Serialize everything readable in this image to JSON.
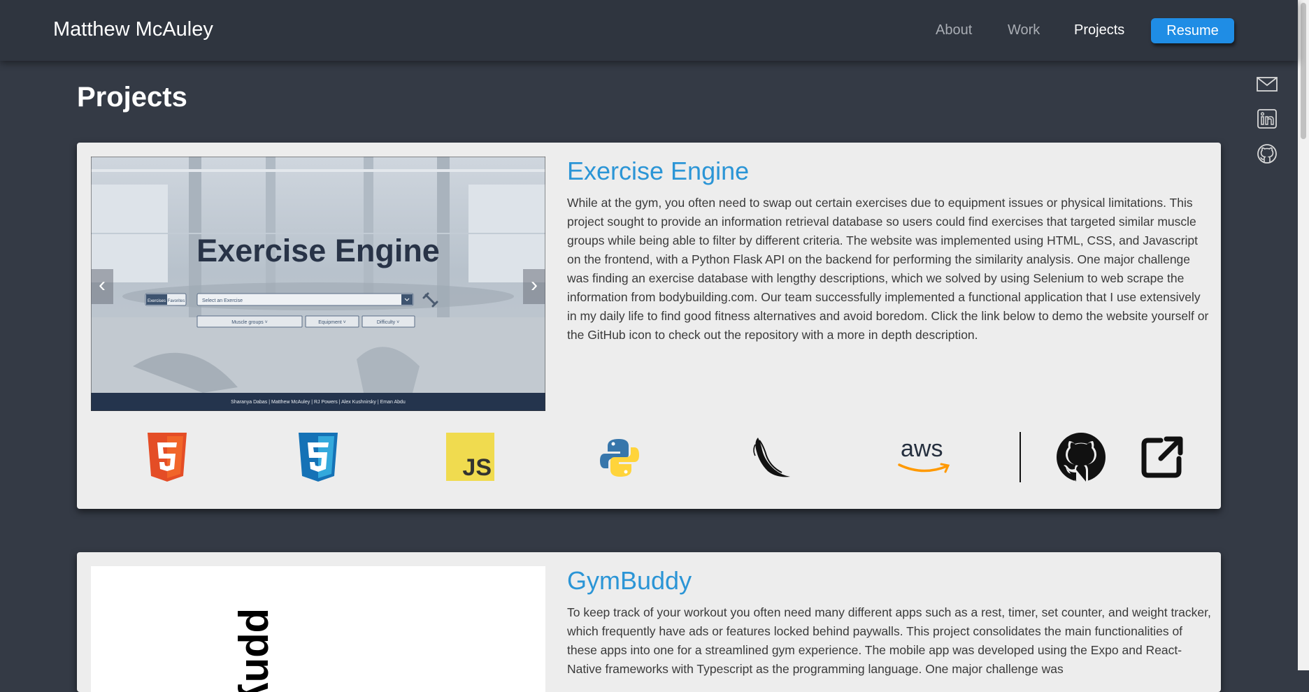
{
  "header": {
    "brand": "Matthew McAuley",
    "nav": {
      "about": "About",
      "work": "Work",
      "projects": "Projects",
      "resume": "Resume"
    }
  },
  "social": [
    "mail-icon",
    "linkedin-icon",
    "github-icon"
  ],
  "page_title": "Projects",
  "projects": [
    {
      "title": "Exercise Engine",
      "description": "While at the gym, you often need to swap out certain exercises due to equipment issues or physical limitations. This project sought to provide an information retrieval database so users could find exercises that targeted similar muscle groups while being able to filter by different criteria. The website was implemented using HTML, CSS, and Javascript on the frontend, with a Python Flask API on the backend for performing the similarity analysis. One major challenge was finding an exercise database with lengthy descriptions, which we solved by using Selenium to web scrape the information from bodybuilding.com. Our team successfully implemented a functional application that I use extensively in my daily life to find good fitness alternatives and avoid boredom. Click the link below to demo the website yourself or the GitHub icon to check out the repository with a more in depth description.",
      "screenshot": {
        "title": "Exercise Engine",
        "tab_exercises": "Exercises",
        "tab_favorites": "Favorites",
        "search_placeholder": "Select an Exercise",
        "filter_muscle": "Muscle groups ˅",
        "filter_equipment": "Equipment ˅",
        "filter_difficulty": "Difficulty ˅",
        "footer": "Sharanya Dabas | Matthew McAuley | RJ Powers | Alex Kushnirsky | Eman Abdu"
      },
      "tech": [
        "HTML5",
        "CSS3",
        "JavaScript",
        "Python",
        "Flask",
        "AWS"
      ],
      "js_label": "JS",
      "aws_label": "aws"
    },
    {
      "title": "GymBuddy",
      "description": "To keep track of your workout you often need many different apps such as a rest, timer, set counter, and weight tracker, which frequently have ads or features locked behind paywalls. This project consolidates the main functionalities of these apps into one for a streamlined gym experience. The mobile app was developed using the Expo and React-Native frameworks with Typescript as the programming language. One major challenge was",
      "logo_text": "ppny"
    }
  ],
  "colors": {
    "accent": "#2b95d6",
    "button": "#1f8de5",
    "background": "#343a45",
    "card": "#ededed"
  }
}
